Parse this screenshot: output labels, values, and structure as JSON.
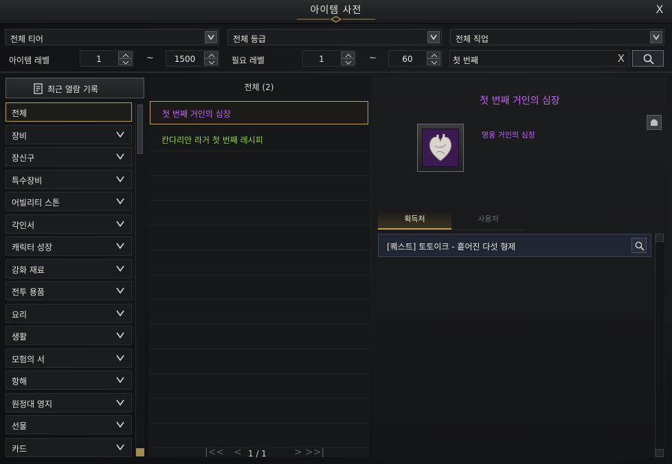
{
  "window": {
    "title": "아이템 사전",
    "close_label": "X"
  },
  "filters": {
    "tier": "전체 티어",
    "grade": "전체 등급",
    "class": "전체 직업",
    "item_level_label": "아이템 레벨",
    "item_level_min": "1",
    "item_level_max": "1500",
    "req_level_label": "필요 레벨",
    "req_level_min": "1",
    "req_level_max": "60",
    "tilde": "~",
    "search_value": "첫 번째",
    "search_clear": "X"
  },
  "sidebar": {
    "recent_label": "최근 열람 기록",
    "items": [
      {
        "label": "전체"
      },
      {
        "label": "장비"
      },
      {
        "label": "장신구"
      },
      {
        "label": "특수장비"
      },
      {
        "label": "어빌리티 스톤"
      },
      {
        "label": "각인서"
      },
      {
        "label": "캐릭터 성장"
      },
      {
        "label": "강화 재료"
      },
      {
        "label": "전투 용품"
      },
      {
        "label": "요리"
      },
      {
        "label": "생활"
      },
      {
        "label": "모험의 서"
      },
      {
        "label": "항해"
      },
      {
        "label": "원정대 영지"
      },
      {
        "label": "선물"
      },
      {
        "label": "카드"
      }
    ]
  },
  "results": {
    "header": "전체 (2)",
    "items": [
      {
        "label": "첫 번째 거인의 심장",
        "color": "#c560ff"
      },
      {
        "label": "칸다리안 라거 첫 번째 레시피",
        "color": "#8fd14f"
      }
    ],
    "pager": {
      "first": "|<<",
      "prev": "<",
      "page": "1 / 1",
      "next": ">",
      "last": ">>|"
    }
  },
  "detail": {
    "title": "첫 번째 거인의 심장",
    "grade_label": "영웅 거인의 심장",
    "tabs": {
      "acquire": "획득처",
      "use": "사용처"
    },
    "sources": [
      {
        "label": "[퀘스트] 토토이크 - 흩어진 다섯 형제"
      }
    ],
    "accent_color": "#c560ff",
    "icon": "heart-item-icon"
  }
}
